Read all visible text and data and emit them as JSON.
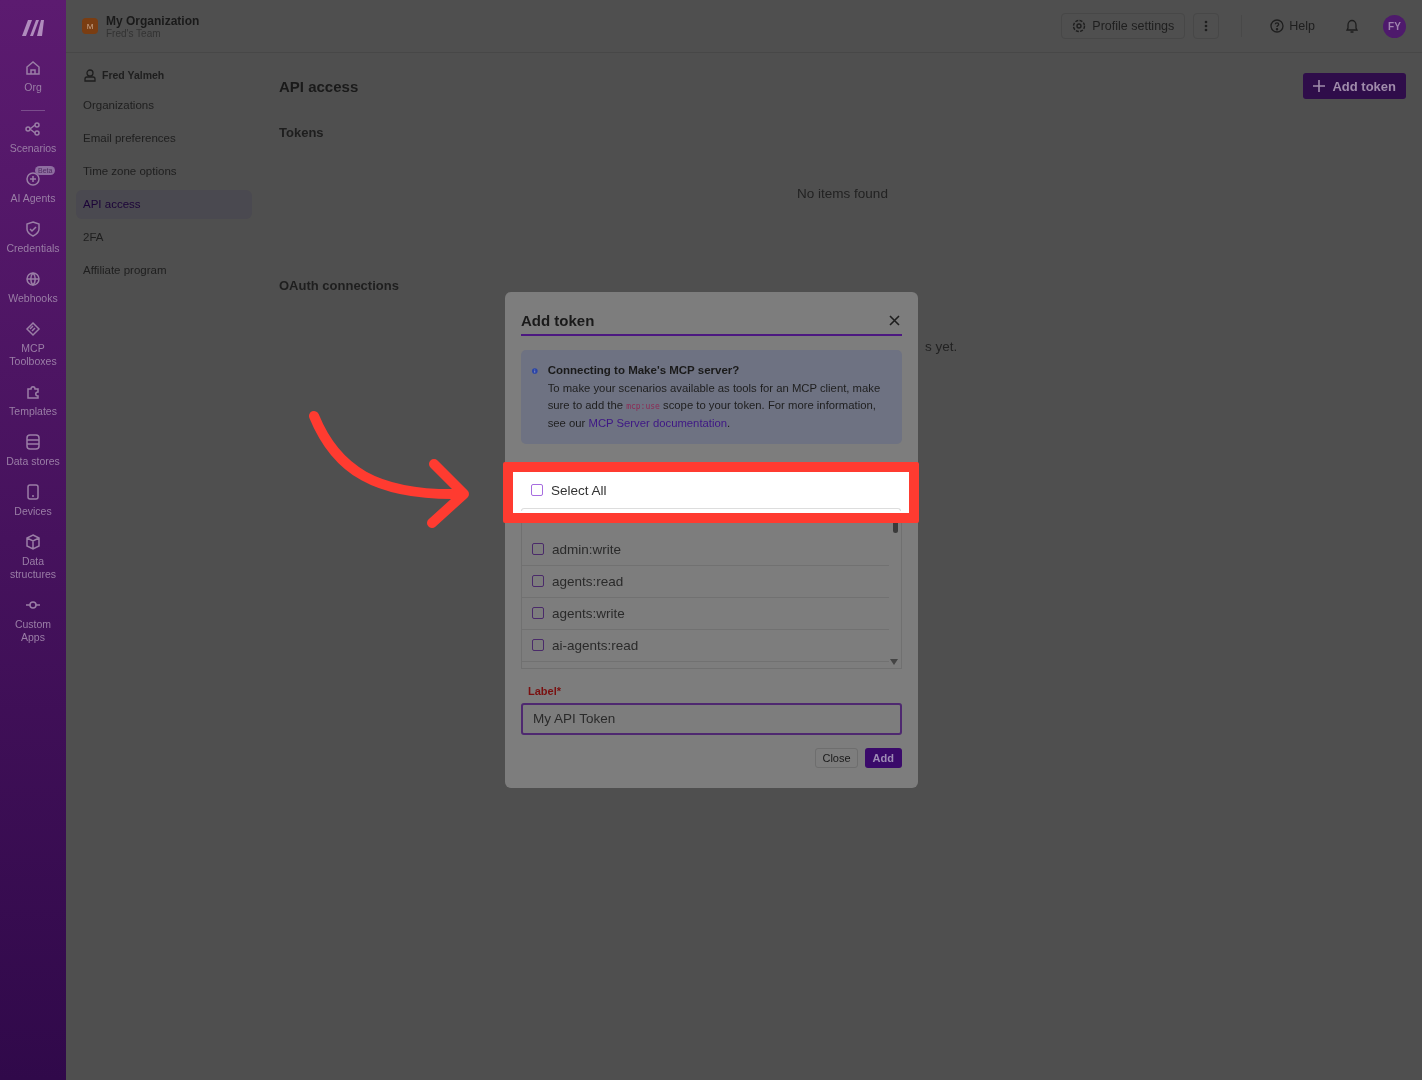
{
  "rail": {
    "items": [
      {
        "label": "Org",
        "kind": "home"
      },
      {
        "label": "Scenarios",
        "kind": "share"
      },
      {
        "label": "AI Agents",
        "kind": "spark",
        "badge": "Beta"
      },
      {
        "label": "Credentials",
        "kind": "shield"
      },
      {
        "label": "Webhooks",
        "kind": "globe"
      },
      {
        "label": "MCP Toolboxes",
        "kind": "layers"
      },
      {
        "label": "Templates",
        "kind": "puzzle"
      },
      {
        "label": "Data stores",
        "kind": "db"
      },
      {
        "label": "Devices",
        "kind": "phone"
      },
      {
        "label": "Data structures",
        "kind": "cube"
      },
      {
        "label": "Custom Apps",
        "kind": "node"
      }
    ]
  },
  "org": {
    "avatar": "M",
    "name": "My Organization",
    "team": "Fred's Team"
  },
  "topbar": {
    "profile_settings": "Profile settings",
    "help": "Help",
    "avatar": "FY"
  },
  "submenu": {
    "user": "Fred Yalmeh",
    "items": [
      {
        "label": "Organizations",
        "selected": false
      },
      {
        "label": "Email preferences",
        "selected": false
      },
      {
        "label": "Time zone options",
        "selected": false
      },
      {
        "label": "API access",
        "selected": true
      },
      {
        "label": "2FA",
        "selected": false
      },
      {
        "label": "Affiliate program",
        "selected": false
      }
    ]
  },
  "page": {
    "title": "API access",
    "add_button": "Add token",
    "tokens_heading": "Tokens",
    "tokens_empty": "No items found",
    "oauth_heading": "OAuth connections",
    "oauth_empty_tail": "s yet."
  },
  "modal": {
    "title": "Add token",
    "info": {
      "title": "Connecting to Make's MCP server?",
      "before": "To make your scenarios available as tools for an MCP client, make sure to add the ",
      "code": "mcp:use",
      "after": " scope to your token. For more information, see our ",
      "link": "MCP Server documentation",
      "end": "."
    },
    "select_all": {
      "label": "Select All",
      "checked": false
    },
    "scopes": [
      {
        "label": "admin:write",
        "checked": false
      },
      {
        "label": "agents:read",
        "checked": false
      },
      {
        "label": "agents:write",
        "checked": false
      },
      {
        "label": "ai-agents:read",
        "checked": false
      }
    ],
    "label_field": {
      "label": "Label",
      "required_mark": "*",
      "placeholder": "My API Token"
    },
    "buttons": {
      "close": "Close",
      "add": "Add"
    }
  }
}
